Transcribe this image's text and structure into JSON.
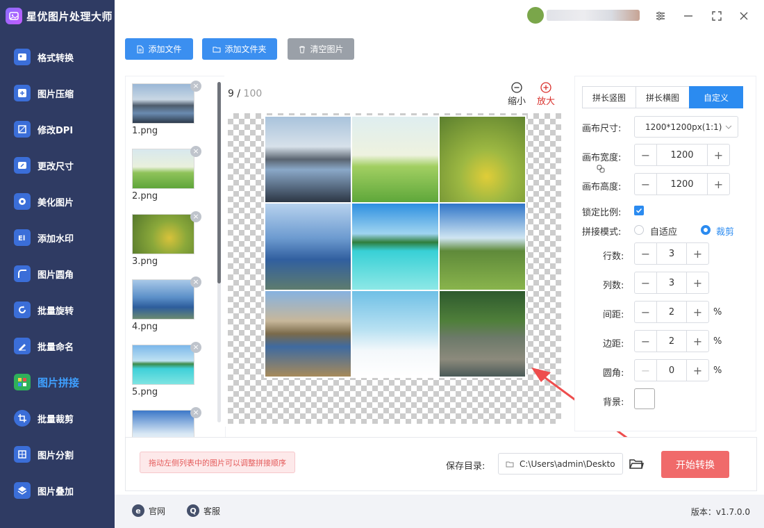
{
  "app": {
    "title": "星优图片处理大师"
  },
  "sidebar": {
    "items": [
      {
        "label": "格式转换",
        "icon": "image-convert-icon"
      },
      {
        "label": "图片压缩",
        "icon": "image-compress-icon"
      },
      {
        "label": "修改DPI",
        "icon": "dpi-icon"
      },
      {
        "label": "更改尺寸",
        "icon": "resize-icon"
      },
      {
        "label": "美化图片",
        "icon": "beautify-icon"
      },
      {
        "label": "添加水印",
        "icon": "watermark-icon"
      },
      {
        "label": "图片圆角",
        "icon": "round-corner-icon"
      },
      {
        "label": "批量旋转",
        "icon": "rotate-icon"
      },
      {
        "label": "批量命名",
        "icon": "rename-icon"
      },
      {
        "label": "图片拼接",
        "icon": "stitch-icon",
        "active": true
      },
      {
        "label": "批量裁剪",
        "icon": "crop-icon"
      },
      {
        "label": "图片分割",
        "icon": "split-icon"
      },
      {
        "label": "图片叠加",
        "icon": "overlay-icon"
      }
    ]
  },
  "toolbar": {
    "add_file": "添加文件",
    "add_folder": "添加文件夹",
    "clear_images": "清空图片"
  },
  "files": [
    "1.png",
    "2.png",
    "3.png",
    "4.png",
    "5.png"
  ],
  "preview": {
    "count": "9",
    "total": "100",
    "zoom_out": "缩小",
    "zoom_in": "放大"
  },
  "settings": {
    "tabs": [
      "拼长竖图",
      "拼长横图",
      "自定义"
    ],
    "active_tab": "自定义",
    "canvas_size_label": "画布尺寸:",
    "canvas_size_value": "1200*1200px(1:1)",
    "canvas_width_label": "画布宽度:",
    "canvas_width": "1200",
    "canvas_height_label": "画布高度:",
    "canvas_height": "1200",
    "lock_ratio_label": "锁定比例:",
    "lock_ratio": true,
    "mode_label": "拼接模式:",
    "mode_auto": "自适应",
    "mode_crop": "裁剪",
    "mode_selected": "裁剪",
    "rows_label": "行数:",
    "rows": "3",
    "cols_label": "列数:",
    "cols": "3",
    "spacing_label": "间距:",
    "spacing": "2",
    "margin_label": "边距:",
    "margin": "2",
    "radius_label": "圆角:",
    "radius": "0",
    "percent": "%",
    "background_label": "背景:",
    "background_color": "#ffffff"
  },
  "bottom": {
    "hint": "拖动左侧列表中的图片可以调整拼接顺序",
    "save_label": "保存目录:",
    "save_path": "C:\\Users\\admin\\Deskto",
    "start": "开始转换"
  },
  "footer": {
    "website": "官网",
    "support": "客服",
    "version": "版本：v1.7.0.0"
  },
  "colors": {
    "sidebar_bg": "#2f3b63",
    "accent": "#2b8bf0",
    "start_button": "#f06a6a",
    "active_nav": "#3fa0ff"
  }
}
